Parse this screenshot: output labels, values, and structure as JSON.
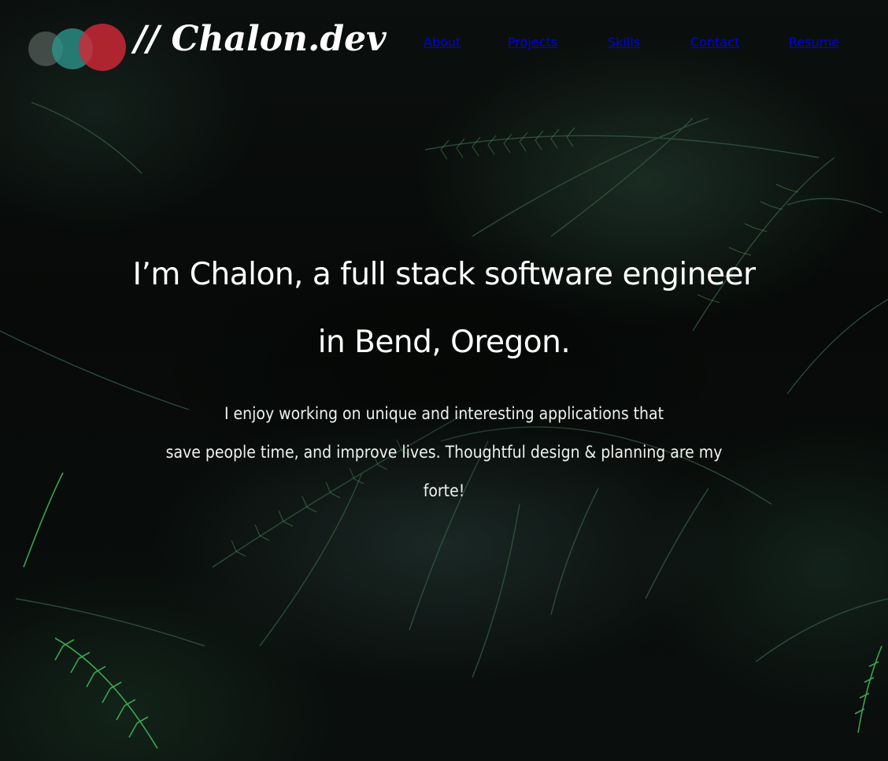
{
  "site": {
    "logo_text": "// Chalon.dev",
    "logo_dot_colors": [
      "#6e7873",
      "#2d968c",
      "#d22837"
    ]
  },
  "nav": {
    "items": [
      {
        "label": "About"
      },
      {
        "label": "Projects"
      },
      {
        "label": "Skills"
      },
      {
        "label": "Contact"
      },
      {
        "label": "Resume"
      }
    ]
  },
  "hero": {
    "headline_line1": "I’m Chalon, a full stack software engineer",
    "headline_line2": "in Bend, Oregon.",
    "intro_line1": "I enjoy working on unique and interesting applications that",
    "intro_line2": "save people time, and improve lives. Thoughtful design & planning are my",
    "intro_line3": "forte!"
  },
  "background": {
    "image": "dark fern leaves",
    "accent_color": "#2f7a4a"
  }
}
